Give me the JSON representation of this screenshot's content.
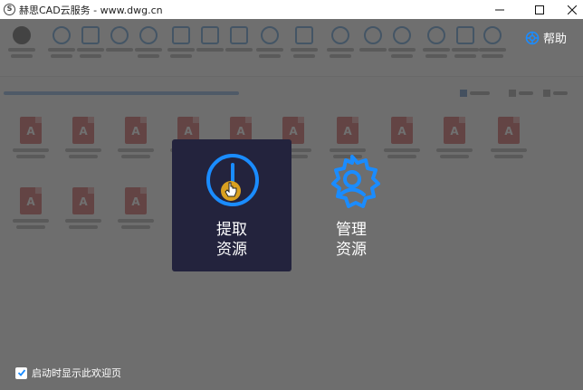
{
  "window": {
    "title": "赫思CAD云服务 - www.dwg.cn",
    "app_icon_letter": "S"
  },
  "help": {
    "label": "帮助"
  },
  "welcome": {
    "extract": {
      "line1": "提取",
      "line2": "资源"
    },
    "manage": {
      "line1": "管理",
      "line2": "资源"
    }
  },
  "startup": {
    "label": "启动时显示此欢迎页",
    "checked": true
  },
  "file_icon": {
    "letter": "A"
  },
  "colors": {
    "accent": "#1a8cff",
    "card": "#23233d",
    "cursor_dot": "#d9a020"
  }
}
